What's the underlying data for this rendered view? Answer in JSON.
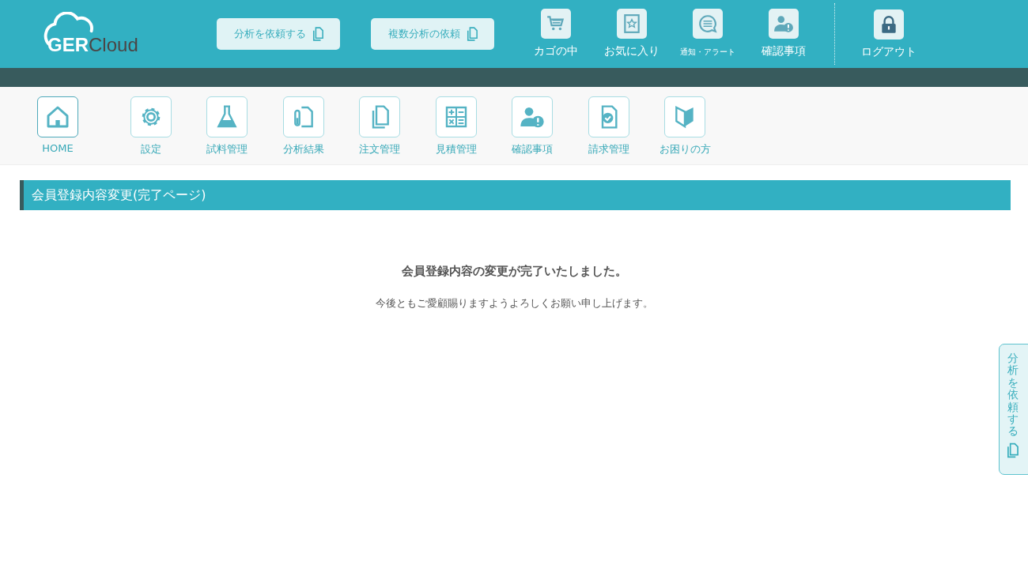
{
  "header": {
    "logo": {
      "part_1": "GER",
      "part_2": "Cloud"
    },
    "buttons": [
      {
        "label": "分析を依頼する"
      },
      {
        "label": "複数分析の依頼"
      }
    ],
    "icon_links": [
      {
        "kind": "cart",
        "label": "カゴの中"
      },
      {
        "kind": "favorite",
        "label": "お気に入り"
      },
      {
        "kind": "notice",
        "label": "通知・アラート",
        "small": true
      },
      {
        "kind": "confirm",
        "label": "確認事項"
      }
    ],
    "logout": {
      "label": "ログアウト"
    }
  },
  "nav": [
    {
      "kind": "home",
      "label": "HOME",
      "selected": true
    },
    {
      "kind": "gear",
      "label": "設定",
      "selected": false
    },
    {
      "kind": "flask",
      "label": "試料管理",
      "selected": false
    },
    {
      "kind": "tube",
      "label": "分析結果",
      "selected": false
    },
    {
      "kind": "copy",
      "label": "注文管理",
      "selected": false
    },
    {
      "kind": "calc",
      "label": "見積管理",
      "selected": false
    },
    {
      "kind": "confirm",
      "label": "確認事項",
      "selected": false
    },
    {
      "kind": "invoice",
      "label": "請求管理",
      "selected": false
    },
    {
      "kind": "beginner",
      "label": "お困りの方",
      "selected": false
    }
  ],
  "page_title": "会員登録内容変更(完了ページ)",
  "message": {
    "heading": "会員登録内容の変更が完了いたしました。",
    "body": "今後ともご愛顧賜りますようよろしくお願い申し上げます。"
  },
  "side_tab": {
    "label": "分析を依頼する"
  }
}
